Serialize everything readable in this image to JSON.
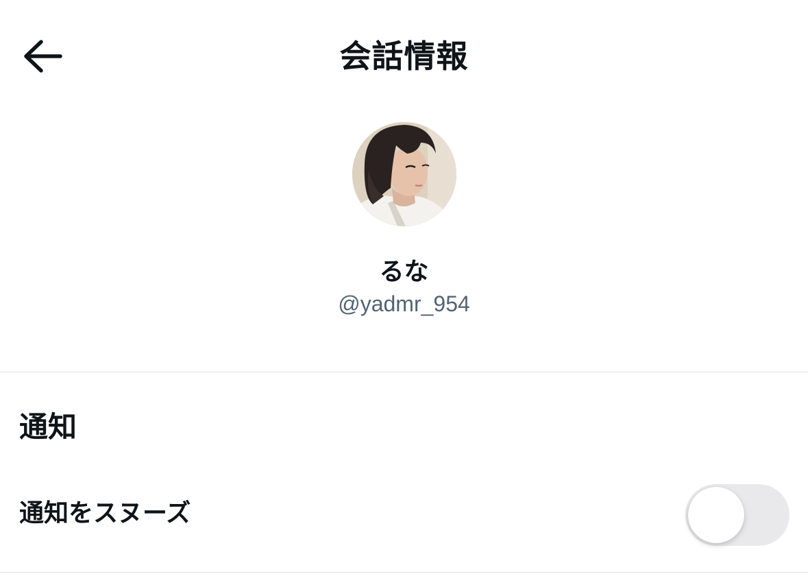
{
  "header": {
    "title": "会話情報",
    "back_icon": "arrow-left-icon"
  },
  "profile": {
    "display_name": "るな",
    "handle": "@yadmr_954"
  },
  "notifications": {
    "section_title": "通知",
    "snooze_label": "通知をスヌーズ",
    "snooze_enabled": false
  },
  "colors": {
    "text_primary": "#0f1419",
    "text_secondary": "#536471",
    "divider": "#dfe3e6",
    "toggle_off_track": "#e9e9eb"
  }
}
